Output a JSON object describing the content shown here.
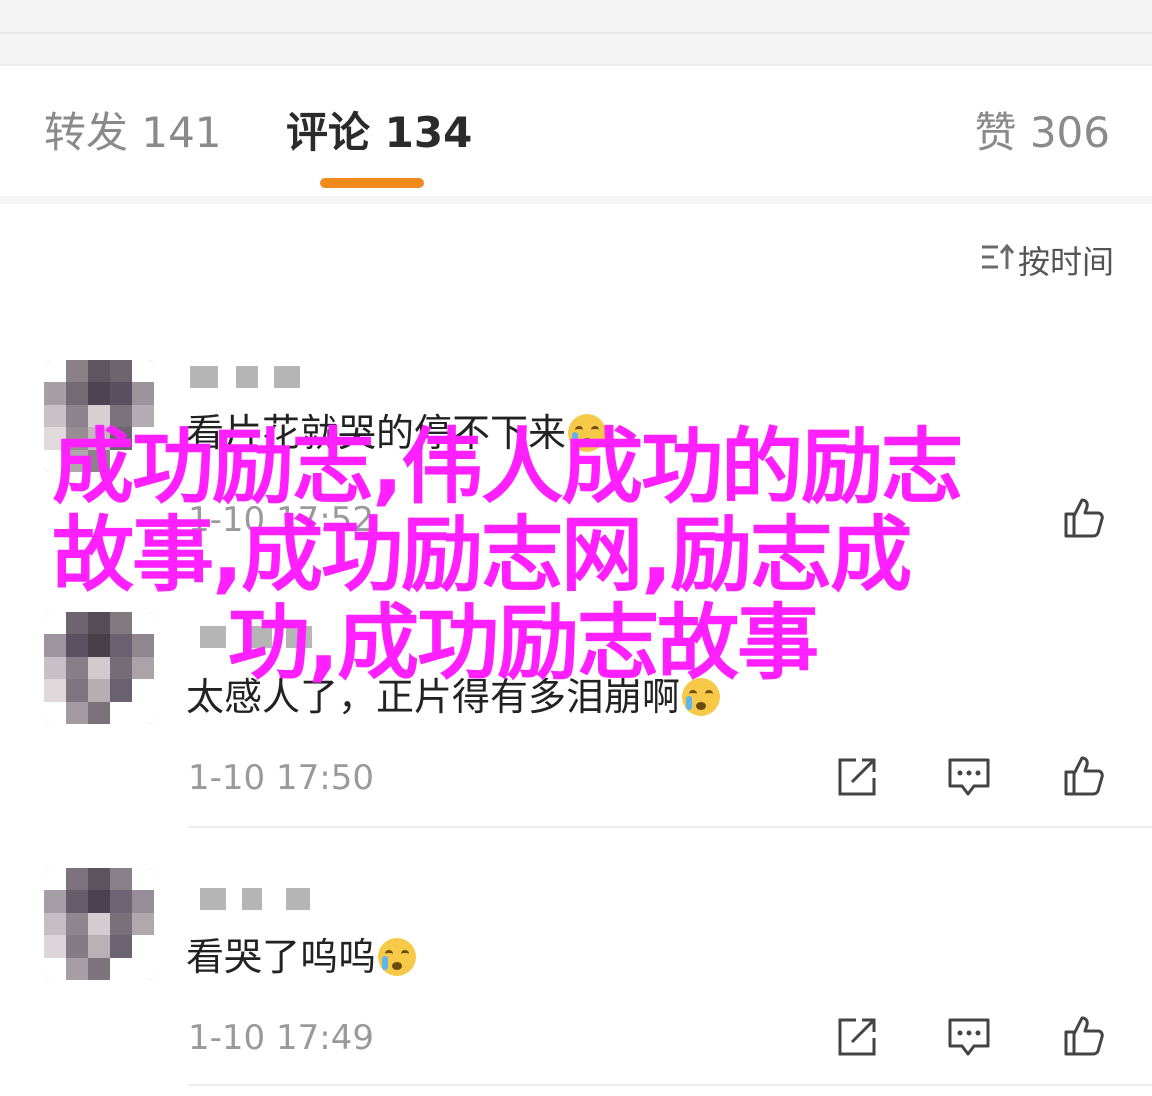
{
  "tabs": [
    {
      "label": "转发 141",
      "active": false
    },
    {
      "label": "评论 134",
      "active": true
    },
    {
      "label": "赞 306",
      "active": false
    }
  ],
  "colors": {
    "accent": "#f08a1c",
    "overlay_text": "#ff1fff",
    "timestamp": "#9a9a9a"
  },
  "sort": {
    "icon": "sort-time-icon",
    "label": "按时间"
  },
  "comments": [
    {
      "text": "看片花就哭的停不下来",
      "emoji": "crying-face-emoji",
      "time": "1-10 17:52"
    },
    {
      "text": "太感人了，正片得有多泪崩啊",
      "emoji": "crying-face-emoji",
      "time": "1-10 17:50"
    },
    {
      "text": "看哭了呜呜",
      "emoji": "crying-face-emoji",
      "time": "1-10 17:49"
    }
  ],
  "action_icons": [
    "share-icon",
    "reply-icon",
    "like-icon"
  ],
  "overlay": {
    "line1": "成功励志,伟人成功的励志",
    "line2": "故事,成功励志网,励志成",
    "line3": "功,成功励志故事"
  }
}
